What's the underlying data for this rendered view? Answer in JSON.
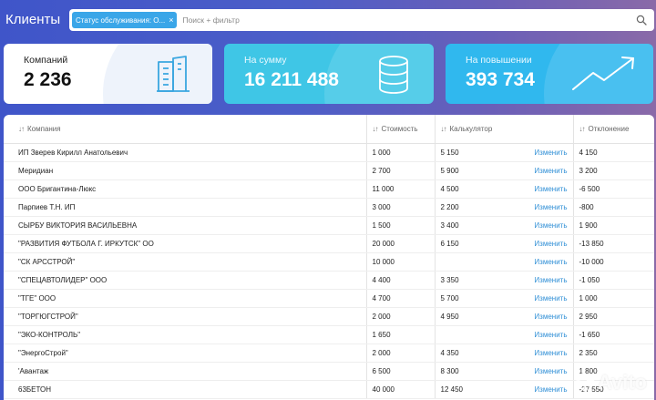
{
  "app": {
    "title": "Клиенты"
  },
  "search": {
    "chip_label": "Статус обслуживания: О...",
    "chip_close": "×",
    "placeholder": "Поиск + фильтр",
    "value": ""
  },
  "cards": [
    {
      "label": "Компаний",
      "value": "2 236",
      "icon": "buildings-icon"
    },
    {
      "label": "На сумму",
      "value": "16 211 488",
      "icon": "database-icon"
    },
    {
      "label": "На повышении",
      "value": "393 734",
      "icon": "trend-up-icon"
    }
  ],
  "table": {
    "columns": [
      "Компания",
      "Стоимость",
      "Калькулятор",
      "Отклонение"
    ],
    "sort_glyph": "↓↑",
    "edit_label": "Изменить",
    "rows": [
      {
        "company": "ИП Зверев Кирилл Анатольевич",
        "cost": "1 000",
        "calc": "5 150",
        "dev": "4 150"
      },
      {
        "company": "Меридиан",
        "cost": "2 700",
        "calc": "5 900",
        "dev": "3 200"
      },
      {
        "company": "ООО Бригантина-Люкс",
        "cost": "11 000",
        "calc": "4 500",
        "dev": "-6 500"
      },
      {
        "company": "Парпиев Т.Н. ИП",
        "cost": "3 000",
        "calc": "2 200",
        "dev": "-800"
      },
      {
        "company": "СЫРБУ ВИКТОРИЯ ВАСИЛЬЕВНА",
        "cost": "1 500",
        "calc": "3 400",
        "dev": "1 900"
      },
      {
        "company": "\"РАЗВИТИЯ ФУТБОЛА Г. ИРКУТСК\" ОО",
        "cost": "20 000",
        "calc": "6 150",
        "dev": "-13 850"
      },
      {
        "company": "\"СК АРССТРОЙ\"",
        "cost": "10 000",
        "calc": "",
        "dev": "-10 000"
      },
      {
        "company": "\"СПЕЦАВТОЛИДЕР\" ООО",
        "cost": "4 400",
        "calc": "3 350",
        "dev": "-1 050"
      },
      {
        "company": "\"ТГЕ\" ООО",
        "cost": "4 700",
        "calc": "5 700",
        "dev": "1 000"
      },
      {
        "company": "\"ТОРГЮГСТРОЙ\"",
        "cost": "2 000",
        "calc": "4 950",
        "dev": "2 950"
      },
      {
        "company": "\"ЭКО-КОНТРОЛЬ\"",
        "cost": "1 650",
        "calc": "",
        "dev": "-1 650"
      },
      {
        "company": "\"ЭнергоСтрой\"",
        "cost": "2 000",
        "calc": "4 350",
        "dev": "2 350"
      },
      {
        "company": "'Авантаж",
        "cost": "6 500",
        "calc": "8 300",
        "dev": "1 800"
      },
      {
        "company": "63БЕТОН",
        "cost": "40 000",
        "calc": "12 450",
        "dev": "-27 550"
      }
    ]
  },
  "watermark": {
    "text": "Avito"
  }
}
